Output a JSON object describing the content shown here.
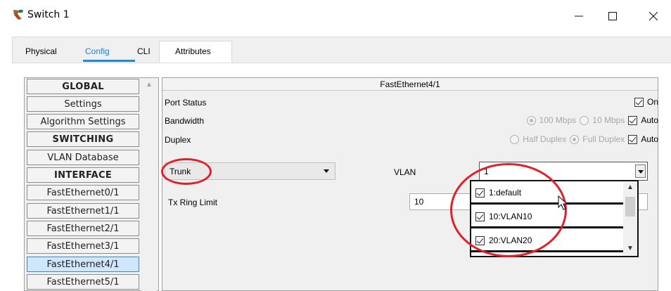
{
  "window": {
    "title": "Switch 1",
    "controls": {
      "minimize": "—",
      "maximize": "☐",
      "close": "✕"
    }
  },
  "tabs": [
    {
      "label": "Physical",
      "active": false
    },
    {
      "label": "Config",
      "active": true
    },
    {
      "label": "CLI",
      "active": false
    },
    {
      "label": "Attributes",
      "active": false
    }
  ],
  "sidebar": {
    "items": [
      {
        "label": "GLOBAL",
        "type": "header"
      },
      {
        "label": "Settings",
        "type": "item"
      },
      {
        "label": "Algorithm Settings",
        "type": "item"
      },
      {
        "label": "SWITCHING",
        "type": "header"
      },
      {
        "label": "VLAN Database",
        "type": "item"
      },
      {
        "label": "INTERFACE",
        "type": "header"
      },
      {
        "label": "FastEthernet0/1",
        "type": "item"
      },
      {
        "label": "FastEthernet1/1",
        "type": "item"
      },
      {
        "label": "FastEthernet2/1",
        "type": "item"
      },
      {
        "label": "FastEthernet3/1",
        "type": "item"
      },
      {
        "label": "FastEthernet4/1",
        "type": "item",
        "selected": true
      },
      {
        "label": "FastEthernet5/1",
        "type": "item"
      }
    ]
  },
  "panel": {
    "title": "FastEthernet4/1",
    "port_status": {
      "label": "Port Status",
      "on_label": "On",
      "on_checked": true
    },
    "bandwidth": {
      "label": "Bandwidth",
      "opt1": "100 Mbps",
      "opt2": "10 Mbps",
      "auto": "Auto"
    },
    "duplex": {
      "label": "Duplex",
      "opt1": "Half Duplex",
      "opt2": "Full Duplex",
      "auto": "Auto"
    },
    "mode_select": {
      "value": "Trunk"
    },
    "vlan": {
      "label": "VLAN",
      "value": "1"
    },
    "tx_ring": {
      "label": "Tx Ring Limit",
      "value": "10"
    },
    "vlan_list": [
      {
        "label": "1:default",
        "checked": true
      },
      {
        "label": "10:VLAN10",
        "checked": true
      },
      {
        "label": "20:VLAN20",
        "checked": true
      }
    ]
  },
  "colors": {
    "accent": "#1a8bd6",
    "highlight_circle": "#e0202a",
    "selected_bg": "#cfe6fb"
  }
}
